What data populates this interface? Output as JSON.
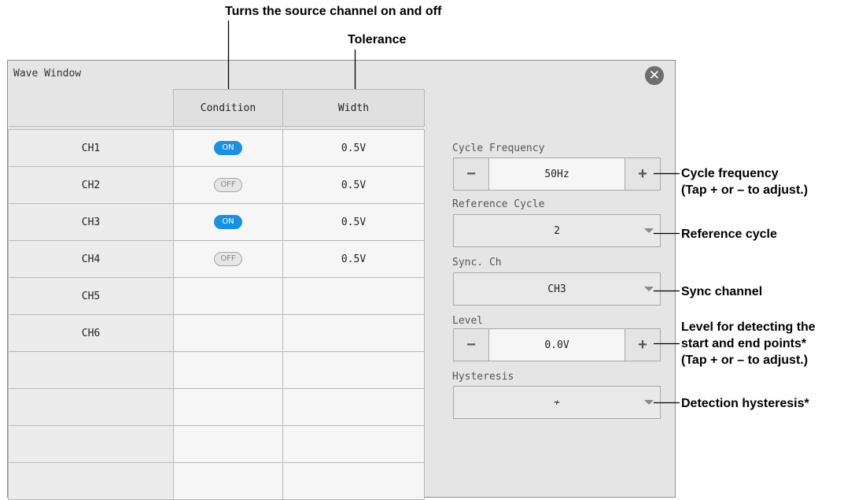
{
  "annotations": {
    "source_channel": "Turns the source channel on and off",
    "tolerance": "Tolerance",
    "cycle_frequency_1": "Cycle frequency",
    "cycle_frequency_2": "(Tap + or – to adjust.)",
    "reference_cycle": "Reference cycle",
    "sync_channel": "Sync channel",
    "level_1": "Level for detecting the",
    "level_2": "start and end points*",
    "level_3": "(Tap + or – to adjust.)",
    "detection_hysteresis": "Detection hysteresis*"
  },
  "window": {
    "title": "Wave Window",
    "close_icon": "close-icon"
  },
  "table": {
    "headers": [
      "",
      "Condition",
      "Width"
    ],
    "rows": [
      {
        "label": "CH1",
        "condition": "ON",
        "width": "0.5V"
      },
      {
        "label": "CH2",
        "condition": "OFF",
        "width": "0.5V"
      },
      {
        "label": "CH3",
        "condition": "ON",
        "width": "0.5V"
      },
      {
        "label": "CH4",
        "condition": "OFF",
        "width": "0.5V"
      },
      {
        "label": "CH5",
        "condition": "",
        "width": ""
      },
      {
        "label": "CH6",
        "condition": "",
        "width": ""
      },
      {
        "label": "",
        "condition": "",
        "width": ""
      },
      {
        "label": "",
        "condition": "",
        "width": ""
      },
      {
        "label": "",
        "condition": "",
        "width": ""
      },
      {
        "label": "",
        "condition": "",
        "width": ""
      }
    ]
  },
  "settings": {
    "cycle_frequency": {
      "label": "Cycle Frequency",
      "value": "50Hz",
      "minus": "−",
      "plus": "+"
    },
    "reference_cycle": {
      "label": "Reference Cycle",
      "value": "2"
    },
    "sync_ch": {
      "label": "Sync. Ch",
      "value": "CH3"
    },
    "level": {
      "label": "Level",
      "value": "0.0V",
      "minus": "−",
      "plus": "+"
    },
    "hysteresis": {
      "label": "Hysteresis",
      "value": "≁"
    }
  },
  "colors": {
    "toggle_on": "#1b8fe0",
    "panel_bg": "#e5e5e5"
  }
}
